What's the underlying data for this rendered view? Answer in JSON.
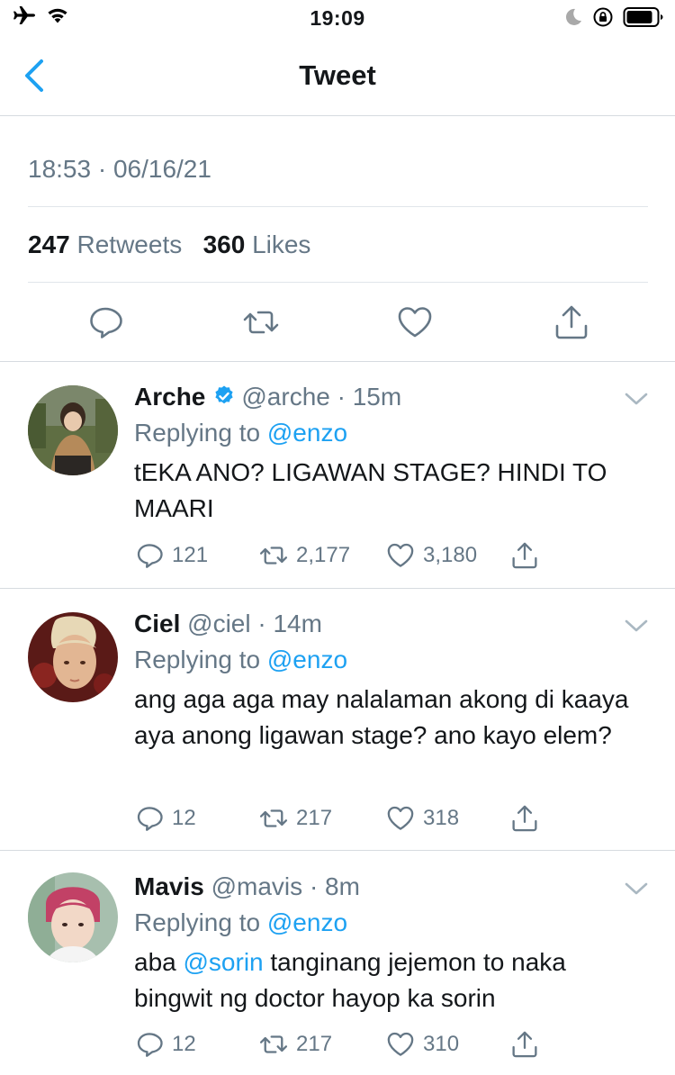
{
  "status_bar": {
    "time": "19:09"
  },
  "nav": {
    "title": "Tweet"
  },
  "tweet": {
    "timestamp": "18:53 · 06/16/21",
    "retweets_count": "247",
    "retweets_label": "Retweets",
    "likes_count": "360",
    "likes_label": "Likes"
  },
  "replies": [
    {
      "name": "Arche",
      "verified": true,
      "handle": "@arche",
      "time": "· 15m",
      "replying_prefix": "Replying to",
      "replying_to": "@enzo",
      "text": "tEKA ANO? LIGAWAN STAGE? HINDI TO MAARI",
      "reply_count": "121",
      "retweet_count": "2,177",
      "like_count": "3,180"
    },
    {
      "name": "Ciel",
      "verified": false,
      "handle": "@ciel",
      "time": "· 14m",
      "replying_prefix": "Replying to",
      "replying_to": "@enzo",
      "text": "ang aga aga may nalalaman akong di kaaya aya anong ligawan stage? ano kayo elem?",
      "reply_count": "12",
      "retweet_count": "217",
      "like_count": "318"
    },
    {
      "name": "Mavis",
      "verified": false,
      "handle": "@mavis",
      "time": "· 8m",
      "replying_prefix": "Replying to",
      "replying_to": "@enzo",
      "text_before": "aba",
      "text_mention": "@sorin",
      "text_after": "tanginang jejemon to naka bingwit ng doctor hayop ka sorin",
      "reply_count": "12",
      "retweet_count": "217",
      "like_count": "310"
    }
  ],
  "colors": {
    "accent": "#1da1f2",
    "muted": "#657786",
    "verified": "#1da1f2"
  }
}
